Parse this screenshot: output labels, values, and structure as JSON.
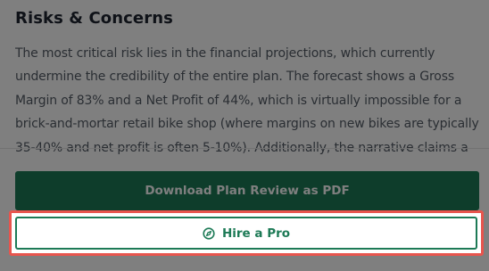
{
  "section": {
    "title": "Risks & Concerns",
    "body": "The most critical risk lies in the financial projections, which currently undermine the credibility of the entire plan. The forecast shows a Gross Margin of 83% and a Net Profit of 44%, which is virtually impossible for a brick-and-mortar retail bike shop (where margins on new bikes are typically 35-40% and net profit is often 5-10%). Additionally, the narrative claims a"
  },
  "actions": {
    "download_label": "Download Plan Review as PDF",
    "hire_label": "Hire a Pro"
  },
  "icons": {
    "hire": "compass-icon"
  },
  "colors": {
    "brand_green": "#1d7a56",
    "highlight_red": "#e8554e",
    "title_text": "#1f2430",
    "body_text": "#555c66"
  }
}
